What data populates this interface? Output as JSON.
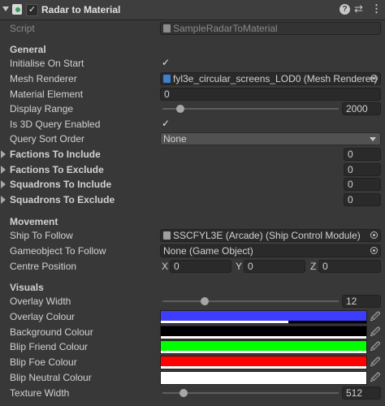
{
  "component": {
    "title": "Radar to Material",
    "enabled_check": "✓",
    "help_icon": "?",
    "settings_icon": "⇄",
    "menu_icon": "⋮"
  },
  "script": {
    "label": "Script",
    "value": "SampleRadarToMaterial"
  },
  "general": {
    "header": "General",
    "initialise_on_start": {
      "label": "Initialise On Start",
      "check": "✓"
    },
    "mesh_renderer": {
      "label": "Mesh Renderer",
      "value": "fyl3e_circular_screens_LOD0 (Mesh Renderer)"
    },
    "material_element": {
      "label": "Material Element",
      "value": "0"
    },
    "display_range": {
      "label": "Display Range",
      "value": "2000",
      "slider_fraction": 0.1
    },
    "is_3d_query": {
      "label": "Is 3D Query Enabled",
      "check": "✓"
    },
    "query_sort_order": {
      "label": "Query Sort Order",
      "value": "None"
    },
    "factions_include": {
      "label": "Factions To Include",
      "value": "0"
    },
    "factions_exclude": {
      "label": "Factions To Exclude",
      "value": "0"
    },
    "squadrons_include": {
      "label": "Squadrons To Include",
      "value": "0"
    },
    "squadrons_exclude": {
      "label": "Squadrons To Exclude",
      "value": "0"
    }
  },
  "movement": {
    "header": "Movement",
    "ship_to_follow": {
      "label": "Ship To Follow",
      "value": "SSCFYL3E (Arcade) (Ship Control Module)"
    },
    "gameobject_to_follow": {
      "label": "Gameobject To Follow",
      "value": "None (Game Object)"
    },
    "centre_position": {
      "label": "Centre Position",
      "x_label": "X",
      "x": "0",
      "y_label": "Y",
      "y": "0",
      "z_label": "Z",
      "z": "0"
    }
  },
  "visuals": {
    "header": "Visuals",
    "overlay_width": {
      "label": "Overlay Width",
      "value": "12",
      "slider_fraction": 0.24
    },
    "overlay_colour": {
      "label": "Overlay Colour",
      "color": "#3d3dff",
      "alpha_fraction": 0.62
    },
    "background_colour": {
      "label": "Background Colour",
      "color": "#000000",
      "alpha_fraction": 1.0
    },
    "blip_friend_colour": {
      "label": "Blip Friend Colour",
      "color": "#00ff00",
      "alpha_fraction": 1.0
    },
    "blip_foe_colour": {
      "label": "Blip Foe Colour",
      "color": "#ff0000",
      "alpha_fraction": 1.0
    },
    "blip_neutral_colour": {
      "label": "Blip Neutral Colour",
      "color": "#ffffff",
      "alpha_fraction": 1.0
    },
    "texture_width": {
      "label": "Texture Width",
      "value": "512",
      "slider_fraction": 0.12
    }
  }
}
